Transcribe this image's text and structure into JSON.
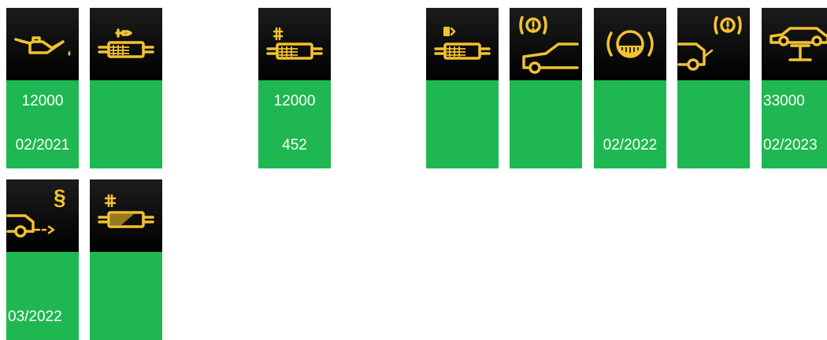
{
  "colors": {
    "icon_background": "#000000",
    "icon_symbol": "#f2c230",
    "status_ok": "#1fb751",
    "text": "#ffffff"
  },
  "tiles": [
    {
      "icon": "oil-can-icon",
      "line1": "12000",
      "line2": "02/2021"
    },
    {
      "icon": "particulate-filter-plug-icon",
      "line1": "",
      "line2": ""
    },
    {
      "icon": "particulate-filter-hash-icon",
      "line1": "12000",
      "line2": "452"
    },
    {
      "icon": "fuel-filter-icon",
      "line1": "",
      "line2": ""
    },
    {
      "icon": "brake-warning-car-front-icon",
      "line1": "",
      "line2": ""
    },
    {
      "icon": "brake-pad-warning-icon",
      "line1": "",
      "line2": "02/2022"
    },
    {
      "icon": "brake-warning-car-rear-icon",
      "line1": "",
      "line2": ""
    },
    {
      "icon": "car-lift-service-icon",
      "line1": "33000",
      "line2": "02/2023"
    },
    {
      "icon": "exhaust-inspection-icon",
      "line1": "",
      "line2": "03/2022"
    },
    {
      "icon": "filter-loaded-icon",
      "line1": "",
      "line2": ""
    }
  ]
}
